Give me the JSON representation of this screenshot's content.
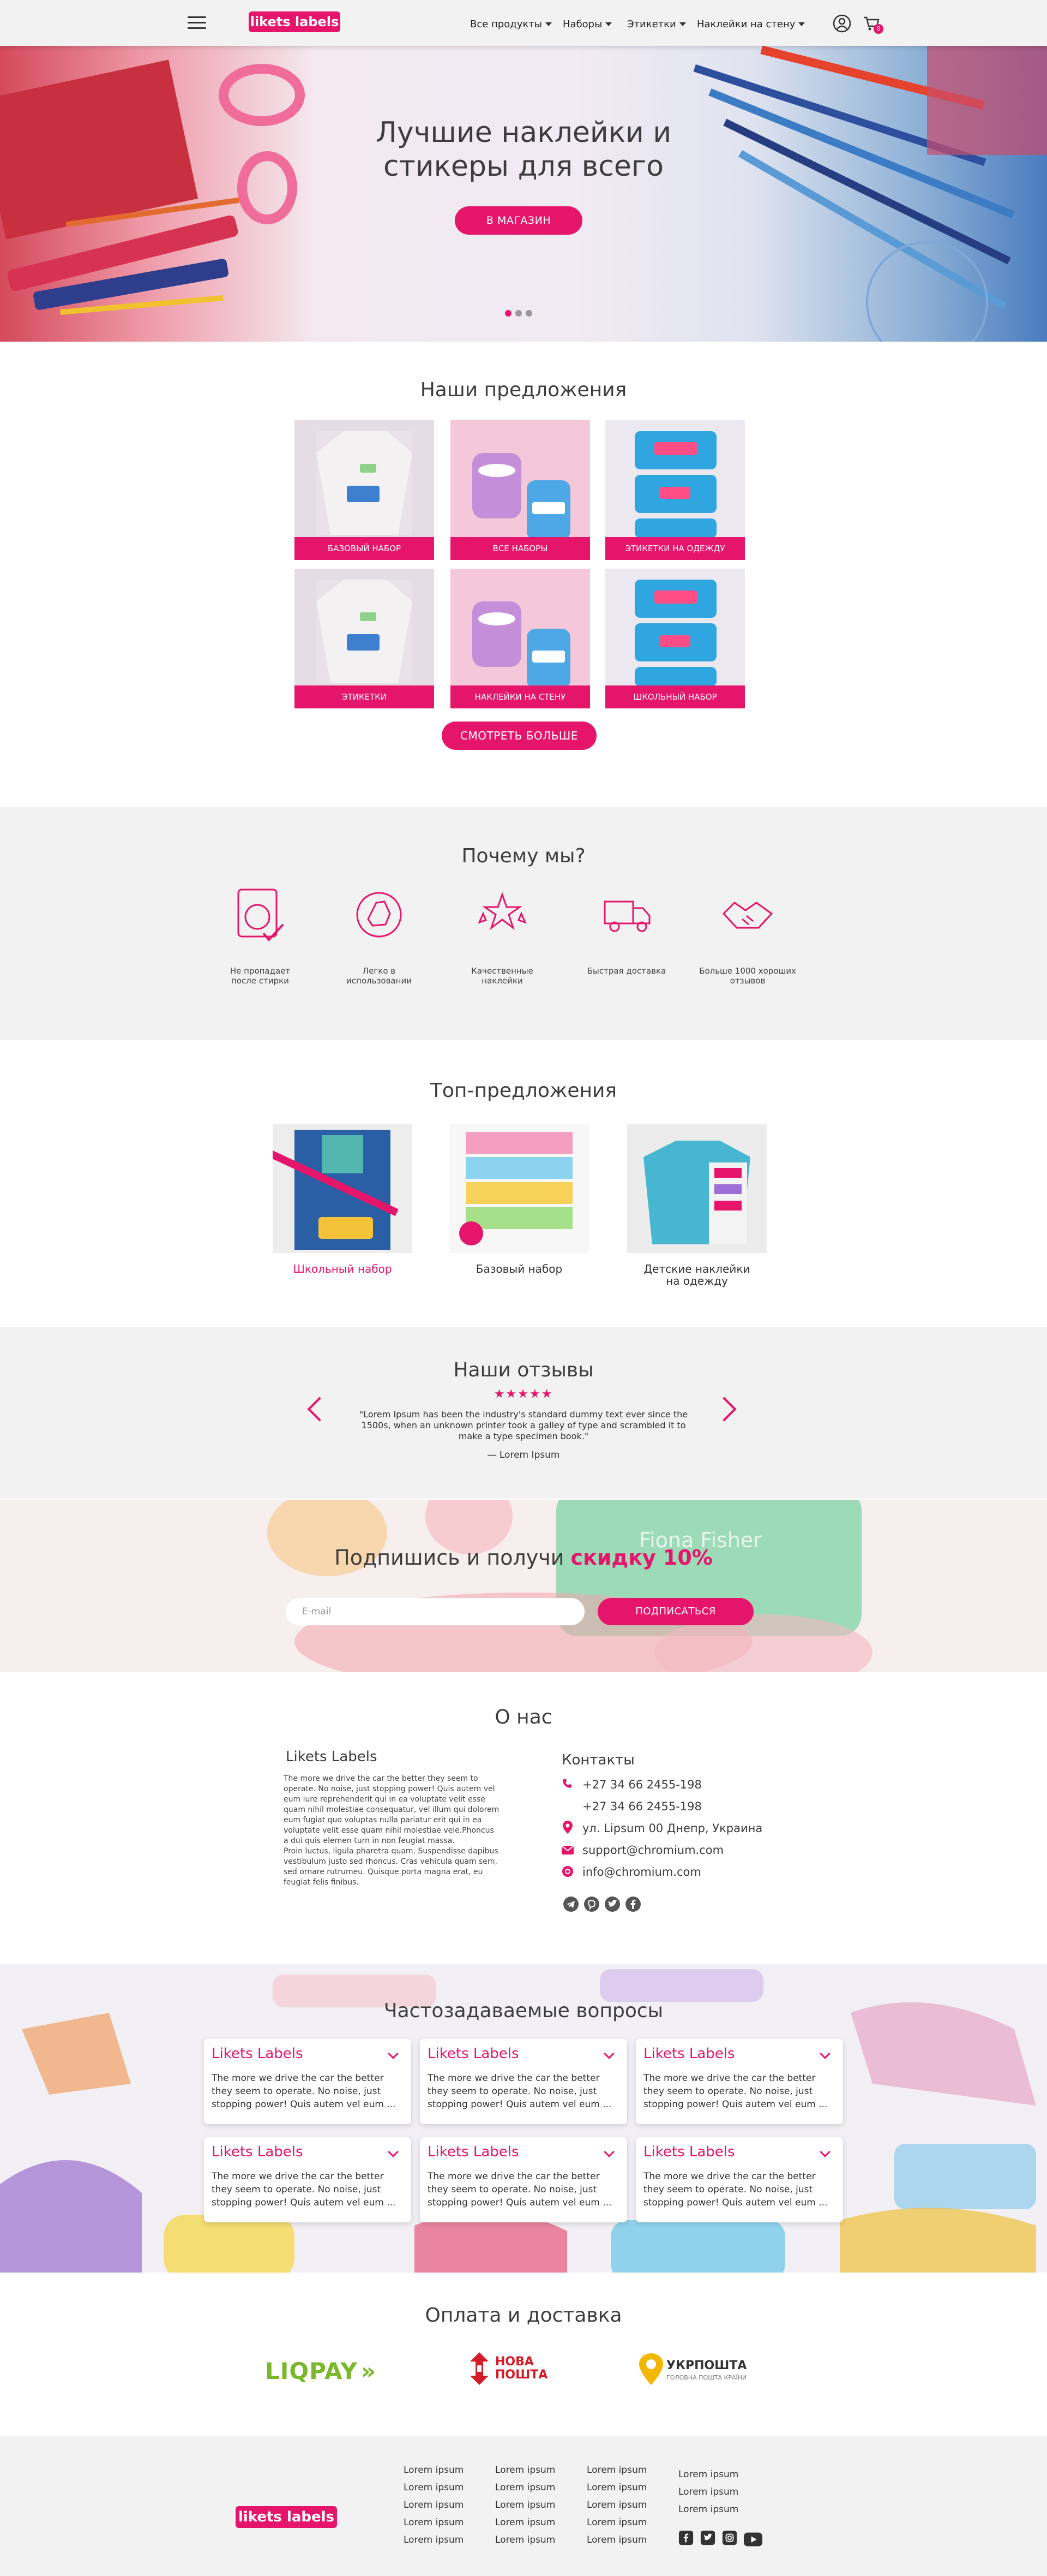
{
  "header": {
    "logo": "likets labels",
    "nav": [
      "Все продукты",
      "Наборы",
      "Этикетки",
      "Наклейки на стену"
    ],
    "cart_count": "0"
  },
  "hero": {
    "title_line1": "Лучшие наклейки и",
    "title_line2": "стикеры для всего",
    "cta": "В МАГАЗИН",
    "slides": 3,
    "active_slide": 1
  },
  "offers": {
    "title": "Наши предложения",
    "items": [
      "БАЗОВЫЙ НАБОР",
      "ВСЕ НАБОРЫ",
      "ЭТИКЕТКИ НА ОДЕЖДУ",
      "ЭТИКЕТКИ",
      "НАКЛЕЙКИ НА СТЕНУ",
      "ШКОЛЬНЫЙ НАБОР"
    ],
    "more_button": "СМОТРЕТЬ БОЛЬШЕ"
  },
  "why": {
    "title": "Почему мы?",
    "items": [
      {
        "icon": "washing-machine-icon",
        "line1": "Не пропадает",
        "line2": "после стирки"
      },
      {
        "icon": "thumbs-up-icon",
        "line1": "Легко в",
        "line2": "использовании"
      },
      {
        "icon": "stars-icon",
        "line1": "Качественные",
        "line2": "наклейки"
      },
      {
        "icon": "delivery-truck-icon",
        "line1": "Быстрая доставка",
        "line2": ""
      },
      {
        "icon": "handshake-icon",
        "line1": "Больше 1000 хороших",
        "line2": "отзывов"
      }
    ]
  },
  "top": {
    "title": "Топ-предложения",
    "items": [
      {
        "line1": "Школьный набор",
        "line2": ""
      },
      {
        "line1": "Базовый набор",
        "line2": ""
      },
      {
        "line1": "Детские наклейки",
        "line2": "на одежду"
      }
    ]
  },
  "reviews": {
    "title": "Наши отзывы",
    "stars": "★★★★★",
    "text_line1": "\"Lorem Ipsum has been the industry's standard dummy text ever since the",
    "text_line2": "1500s, when an unknown printer took a galley of type and scrambled it to",
    "text_line3": "make a type specimen book.\"",
    "author": "— Lorem Ipsum"
  },
  "subscribe": {
    "title_start": "Подпишись и получи ",
    "title_highlight": "скидку 10%",
    "email_placeholder": "E-mail",
    "button": "ПОДПИСАТЬСЯ",
    "bg_text": "Fiona Fisher"
  },
  "about": {
    "title": "О нас",
    "company": "Likets Labels",
    "lines": [
      "The more we drive the car the better they seem to",
      "operate. No noise, just stopping power! Quis autem vel",
      "eum iure reprehenderit qui in ea voluptate velit esse",
      "quam nihil molestiae consequatur, vel illum qui dolorem",
      "eum fugiat quo voluptas nulla pariatur erit qui in ea",
      "voluptate velit esse quam nihil molestiae vele.Phoncus",
      "a dui quis elemen turn in non feugiat massa.",
      "Proin luctus, ligula pharetra quam. Suspendisse dapibus",
      "vestibulum justo sed rhoncus. Cras vehicula quam sem,",
      "sed ornare rutrumeu. Quisque porta magna erat, eu",
      "feugiat felis finibus."
    ],
    "contacts_title": "Контакты",
    "phone1": "+27 34 66 2455-198",
    "phone2": "+27 34 66 2455-198",
    "address": "ул. Lipsum 00 Днепр, Украина",
    "email1": "support@chromium.com",
    "email2": "info@chromium.com",
    "socials": [
      "telegram-icon",
      "viber-icon",
      "twitter-icon",
      "facebook-icon"
    ]
  },
  "faq": {
    "title": "Частозадаваемые вопросы",
    "question": "Likets Labels",
    "answer_line1": "The more we drive the car the better",
    "answer_line2": "they seem to operate. No noise, just",
    "answer_line3": "stopping power! Quis autem vel eum ..."
  },
  "payment": {
    "title": "Оплата и доставка",
    "liqpay": "LIQPAY",
    "nova1": "НОВА",
    "nova2": "ПОШТА",
    "ukr1": "УКРПОШТА",
    "ukr2": "ГОЛОВНА ПОШТА КРАЇНИ"
  },
  "footer": {
    "logo": "likets labels",
    "link": "Lorem ipsum",
    "socials": [
      "facebook-icon",
      "twitter-icon",
      "instagram-icon",
      "youtube-icon"
    ]
  },
  "colors": {
    "accent": "#e5156b",
    "band": "#f2f2f2",
    "liqpay": "#7ab72b",
    "nova": "#d41c27",
    "ukr": "#f2b800"
  }
}
